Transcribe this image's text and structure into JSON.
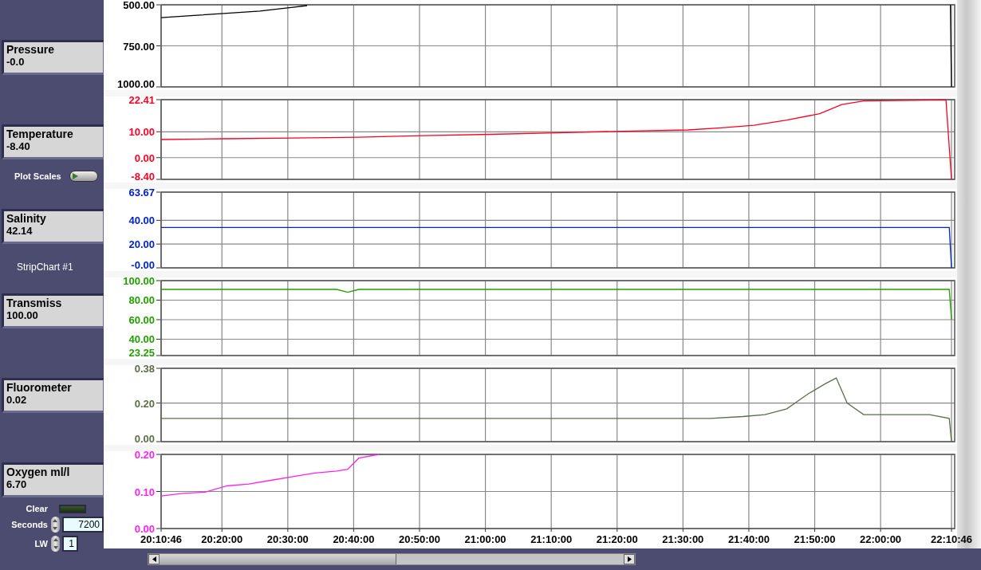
{
  "panel_items": [
    {
      "kind": "indicator",
      "label": "Pressure",
      "value": "-0.0"
    },
    {
      "kind": "indicator",
      "label": "Temperature",
      "value": "-8.40"
    },
    {
      "kind": "toggle",
      "label": "Plot Scales",
      "on": false
    },
    {
      "kind": "indicator",
      "label": "Salinity",
      "value": "42.14"
    },
    {
      "kind": "caption",
      "label": "StripChart #1"
    },
    {
      "kind": "indicator",
      "label": "Transmiss",
      "value": "100.00"
    },
    {
      "kind": "indicator",
      "label": "Fluorometer",
      "value": "0.02"
    },
    {
      "kind": "indicator",
      "label": "Oxygen ml/l",
      "value": "6.70"
    }
  ],
  "clear": {
    "label": "Clear"
  },
  "seconds": {
    "label": "Seconds",
    "value": "7200"
  },
  "line_width": {
    "label": "LW",
    "value": "1"
  },
  "charts": [
    {
      "chart_data": {
        "type": "line",
        "grid": true,
        "xlim": [
          72646,
          79846
        ],
        "ylim": [
          1000,
          500
        ],
        "yticks": [
          {
            "value": 500,
            "label": "500.00"
          },
          {
            "value": 750,
            "label": "750.00"
          },
          {
            "value": 1000,
            "label": "1000.00"
          }
        ],
        "x": [
          72646,
          72946,
          73246,
          73546,
          73846,
          73976,
          73986,
          79831,
          79836,
          79846
        ],
        "series": [
          {
            "color": "#000000",
            "values": [
              578,
              565,
              552,
              538,
              515,
              505,
              null,
              null,
              500,
              1000
            ]
          }
        ]
      }
    },
    {
      "chart_data": {
        "type": "line",
        "grid": true,
        "xlim": [
          72646,
          79846
        ],
        "ylim": [
          -8.4,
          22.41
        ],
        "yticks": [
          {
            "value": -8.4,
            "label": "-8.40"
          },
          {
            "value": 0,
            "label": "0.00"
          },
          {
            "value": 10,
            "label": "10.00"
          },
          {
            "value": 22.41,
            "label": "22.41"
          }
        ],
        "x": [
          72646,
          73246,
          73846,
          74446,
          75046,
          75646,
          76246,
          76846,
          77446,
          77746,
          78046,
          78346,
          78646,
          78846,
          79046,
          79796,
          79846
        ],
        "series": [
          {
            "color": "#ff0022",
            "values": [
              7,
              7.3,
              7.6,
              7.9,
              8.5,
              9,
              9.6,
              10.2,
              10.7,
              11.5,
              12.5,
              14.5,
              17,
              20.5,
              21.9,
              22.3,
              -8.4
            ]
          }
        ]
      }
    },
    {
      "chart_data": {
        "type": "line",
        "grid": true,
        "xlim": [
          72646,
          79846
        ],
        "ylim": [
          0,
          63.67
        ],
        "yticks": [
          {
            "value": 0,
            "label": "-0.00"
          },
          {
            "value": 20,
            "label": "20.00"
          },
          {
            "value": 40,
            "label": "40.00"
          },
          {
            "value": 63.67,
            "label": "63.67"
          }
        ],
        "x": [
          72646,
          73646,
          74646,
          75646,
          76646,
          77646,
          78646,
          79826,
          79846
        ],
        "series": [
          {
            "color": "#0022cc",
            "values": [
              34,
              34,
              34,
              34,
              34,
              34,
              34,
              34,
              0
            ]
          }
        ]
      }
    },
    {
      "chart_data": {
        "type": "line",
        "grid": true,
        "xlim": [
          72646,
          79846
        ],
        "ylim": [
          23.25,
          100
        ],
        "yticks": [
          {
            "value": 23.25,
            "label": "23.25"
          },
          {
            "value": 40,
            "label": "40.00"
          },
          {
            "value": 60,
            "label": "60.00"
          },
          {
            "value": 80,
            "label": "80.00"
          },
          {
            "value": 100,
            "label": "100.00"
          }
        ],
        "x": [
          72646,
          74246,
          74346,
          74446,
          75646,
          76646,
          77646,
          78646,
          79826,
          79846
        ],
        "series": [
          {
            "color": "#22a000",
            "values": [
              91,
              91,
              88,
              91,
              91,
              91,
              91,
              91,
              91,
              60
            ]
          }
        ]
      }
    },
    {
      "chart_data": {
        "type": "line",
        "grid": true,
        "xlim": [
          72646,
          79846
        ],
        "ylim": [
          0,
          0.38
        ],
        "yticks": [
          {
            "value": 0,
            "label": "0.00"
          },
          {
            "value": 0.2,
            "label": "0.20"
          },
          {
            "value": 0.38,
            "label": "0.38"
          }
        ],
        "x": [
          72646,
          73646,
          74646,
          75646,
          76646,
          77646,
          77946,
          78146,
          78346,
          78546,
          78696,
          78796,
          78896,
          79046,
          79646,
          79826,
          79846
        ],
        "series": [
          {
            "color": "#5a6e48",
            "values": [
              0.12,
              0.12,
              0.12,
              0.12,
              0.12,
              0.12,
              0.13,
              0.14,
              0.17,
              0.25,
              0.3,
              0.33,
              0.2,
              0.14,
              0.14,
              0.12,
              0
            ]
          }
        ]
      }
    },
    {
      "chart_data": {
        "type": "line",
        "grid": true,
        "xlim": [
          72646,
          79846
        ],
        "ylim": [
          0,
          0.2
        ],
        "yticks": [
          {
            "value": 0,
            "label": "0.00"
          },
          {
            "value": 0.1,
            "label": "0.10"
          },
          {
            "value": 0.2,
            "label": "0.20"
          }
        ],
        "xticks": [
          {
            "value": 72646,
            "label": "20:10:46"
          },
          {
            "value": 73200,
            "label": "20:20:00"
          },
          {
            "value": 73800,
            "label": "20:30:00"
          },
          {
            "value": 74400,
            "label": "20:40:00"
          },
          {
            "value": 75000,
            "label": "20:50:00"
          },
          {
            "value": 75600,
            "label": "21:00:00"
          },
          {
            "value": 76200,
            "label": "21:10:00"
          },
          {
            "value": 76800,
            "label": "21:20:00"
          },
          {
            "value": 77400,
            "label": "21:30:00"
          },
          {
            "value": 78000,
            "label": "21:40:00"
          },
          {
            "value": 78600,
            "label": "21:50:00"
          },
          {
            "value": 79200,
            "label": "22:00:00"
          },
          {
            "value": 79846,
            "label": "22:10:46"
          }
        ],
        "x": [
          72646,
          72846,
          73046,
          73246,
          73446,
          73646,
          73846,
          74046,
          74246,
          74346,
          74446,
          74630
        ],
        "series": [
          {
            "color": "#ff22ee",
            "values": [
              0.088,
              0.095,
              0.098,
              0.115,
              0.12,
              0.13,
              0.14,
              0.15,
              0.155,
              0.16,
              0.19,
              0.2
            ]
          }
        ]
      }
    }
  ]
}
